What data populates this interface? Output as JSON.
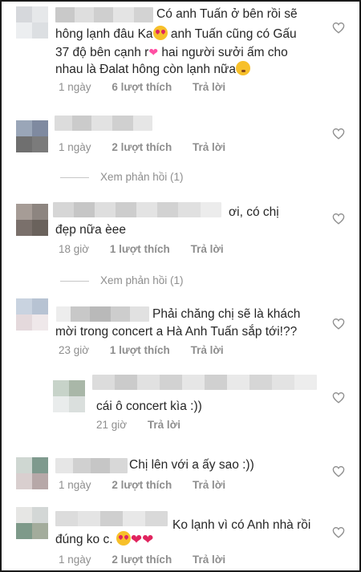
{
  "comments": [
    {
      "text": [
        "Có anh Tuấn ở bên rồi sẽ",
        "hông lạnh đâu Ka",
        " anh Tuấn cũng có Gấu",
        "37 độ bên cạnh r",
        " hai người sưởi ấm cho",
        "nhau là Đalat hông còn lạnh nữa"
      ],
      "time": "1 ngày",
      "likes": "6 lượt thích",
      "reply": "Trả lời"
    },
    {
      "text": [],
      "time": "1 ngày",
      "likes": "2 lượt thích",
      "reply": "Trả lời",
      "view_replies": "Xem phản hồi (1)"
    },
    {
      "text": [
        "ơi, có chị",
        "đẹp nữa èee"
      ],
      "time": "18 giờ",
      "likes": "1 lượt thích",
      "reply": "Trả lời",
      "view_replies": "Xem phản hồi (1)"
    },
    {
      "text": [
        "Phải chăng chị sẽ là khách",
        "mời trong concert a Hà Anh Tuấn sắp tới!??"
      ],
      "time": "23 giờ",
      "likes": "1 lượt thích",
      "reply": "Trả lời"
    },
    {
      "text": [
        "cái ô concert kìa :))"
      ],
      "time": "21 giờ",
      "reply": "Trả lời"
    },
    {
      "text": [
        "Chị lên với a ấy sao :))"
      ],
      "time": "1 ngày",
      "likes": "2 lượt thích",
      "reply": "Trả lời"
    },
    {
      "text": [
        "Ko lạnh vì có Anh nhà rồi",
        "đúng ko c. "
      ],
      "time": "1 ngày",
      "likes": "2 lượt thích",
      "reply": "Trả lời"
    }
  ],
  "colors": {
    "text": "#262626",
    "meta": "#8e8e8e",
    "heart_outline": "#8e8e8e",
    "emoji_heart": "#e0245e"
  },
  "icons": [
    "heart-outline-icon",
    "heart-eyes-emoji",
    "pink-heart-emoji",
    "kissing-emoji",
    "red-heart-emoji"
  ]
}
